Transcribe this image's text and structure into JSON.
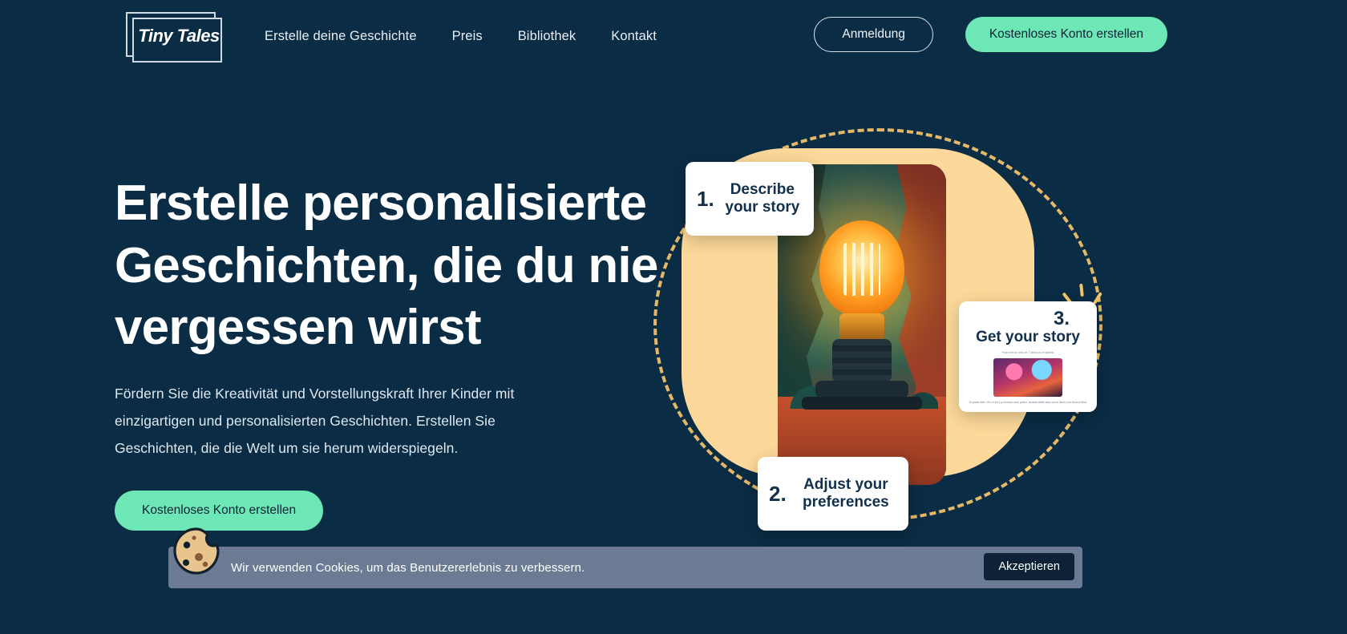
{
  "brand": {
    "name": "Tiny Tales"
  },
  "nav": {
    "items": [
      {
        "label": "Erstelle deine Geschichte"
      },
      {
        "label": "Preis"
      },
      {
        "label": "Bibliothek"
      },
      {
        "label": "Kontakt"
      }
    ],
    "login_label": "Anmeldung",
    "signup_label": "Kostenloses Konto erstellen"
  },
  "hero": {
    "title": "Erstelle personalisierte Geschichten, die du nie vergessen wirst",
    "subtitle": "Fördern Sie die Kreativität und Vorstellungskraft Ihrer Kinder mit einzigartigen und personalisierten Geschichten. Erstellen Sie Geschichten, die die Welt um sie herum widerspiegeln.",
    "cta_label": "Kostenloses Konto erstellen"
  },
  "steps": [
    {
      "number": "1.",
      "text": "Describe your story"
    },
    {
      "number": "2.",
      "text": "Adjust your preferences"
    },
    {
      "number": "3.",
      "text": "Get your story"
    }
  ],
  "step3_preview": {
    "caption": "Pedro era un niño de 7 años con el cabello",
    "footer": "Su padre dice: «Es un sol y yo dormía como podría, durante veinte años con el llanto y los lloros al final."
  },
  "cookie": {
    "message": "Wir verwenden Cookies, um das Benutzererlebnis zu verbessern.",
    "accept_label": "Akzeptieren"
  },
  "colors": {
    "background": "#0a2c44",
    "accent": "#6ee7b7",
    "card_text": "#122f4b",
    "blob": "#fcd99a",
    "cookie_bar": "#6c7b94"
  }
}
